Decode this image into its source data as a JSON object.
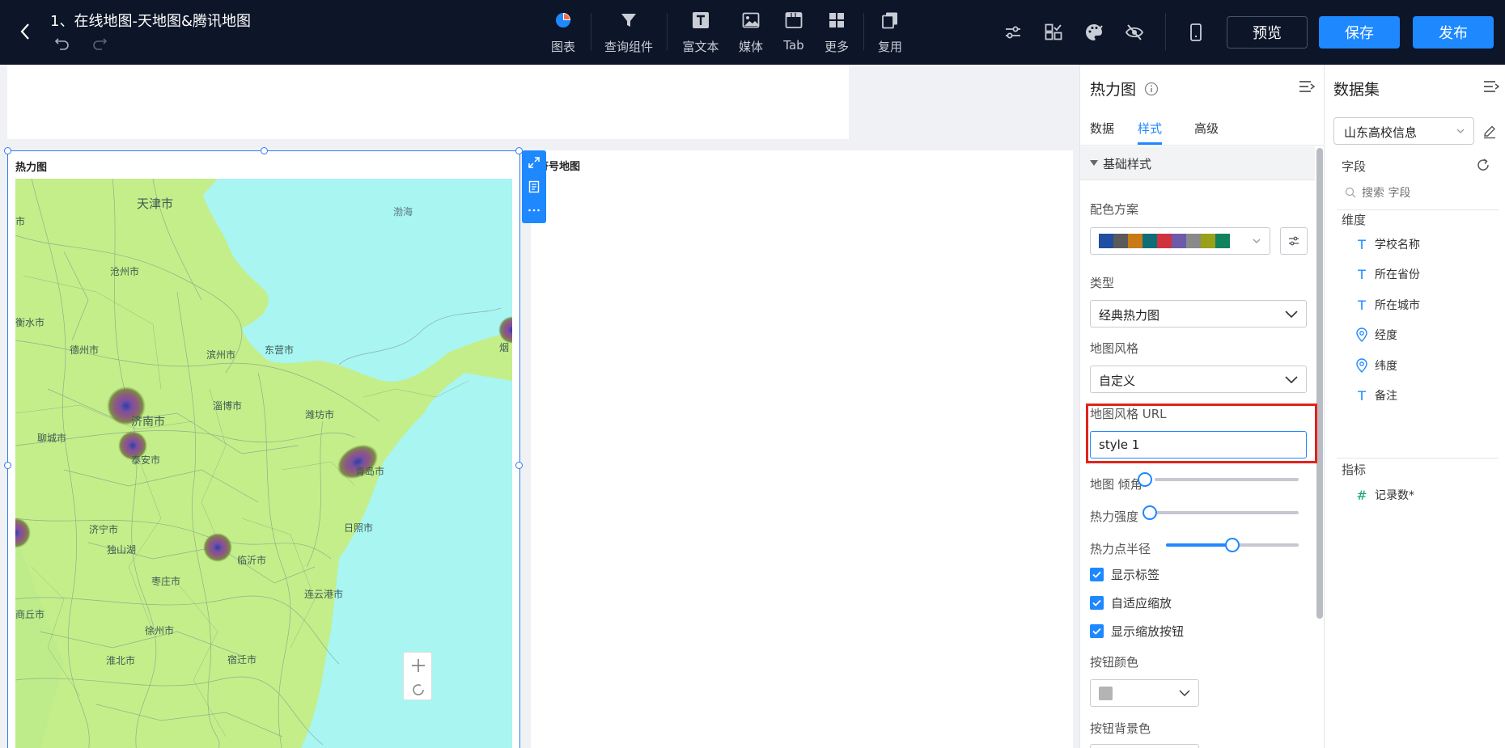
{
  "header": {
    "title": "1、在线地图-天地图&腾讯地图",
    "toolbar": {
      "chart": "图表",
      "query": "查询组件",
      "richtext": "富文本",
      "media": "媒体",
      "tab": "Tab",
      "more": "更多",
      "reuse": "复用"
    },
    "buttons": {
      "preview": "预览",
      "save": "保存",
      "publish": "发布"
    }
  },
  "canvas": {
    "heatmap_card_title": "热力图",
    "symbol_map_card_title": "符号地图",
    "map_labels": {
      "tianjin": "天津市",
      "bohai": "渤海",
      "cangzhou": "沧州市",
      "hengshui": "衡水市",
      "dezhou": "德州市",
      "binzhou": "滨州市",
      "dongying": "东营市",
      "yantai": "烟",
      "zibo": "淄博市",
      "weifang": "潍坊市",
      "jinan": "济南市",
      "liaocheng": "聊城市",
      "taian": "泰安市",
      "qingdao": "青岛市",
      "jining": "济宁市",
      "rizhao": "日照市",
      "dushanhu": "独山湖",
      "linyi": "临沂市",
      "zaozhuang": "枣庄市",
      "lianyungang": "连云港市",
      "xuzhou": "徐州市",
      "suqian": "宿迁市",
      "huaibei": "淮北市",
      "shangqiu": "商丘市",
      "shi_left": "市"
    }
  },
  "properties": {
    "header": "热力图",
    "tabs": [
      "数据",
      "样式",
      "高级"
    ],
    "active_tab": "样式",
    "section": "基础样式",
    "color_scheme_label": "配色方案",
    "color_scheme": [
      "#1f4ea3",
      "#5a5a5a",
      "#c87a17",
      "#0f6d78",
      "#cf3340",
      "#6d5aa8",
      "#8a8a8a",
      "#9aa01a",
      "#12815f"
    ],
    "type_label": "类型",
    "type_value": "经典热力图",
    "map_style_label": "地图风格",
    "map_style_value": "自定义",
    "map_style_url_label": "地图风格 URL",
    "map_style_url_value": "style 1",
    "map_tilt_label": "地图 倾角",
    "map_tilt": 0,
    "heat_intensity_label": "热力强度",
    "heat_intensity": 0,
    "heat_radius_label": "热力点半径",
    "heat_radius": 0.5,
    "show_label": "显示标签",
    "auto_zoom": "自适应缩放",
    "show_zoom_buttons": "显示缩放按钮",
    "button_color_label": "按钮颜色",
    "button_bg_color_label": "按钮背景色"
  },
  "dataset": {
    "header": "数据集",
    "selected": "山东高校信息",
    "fields_label": "字段",
    "search_placeholder": "搜索 字段",
    "dimensions_label": "维度",
    "dimensions": [
      {
        "name": "学校名称",
        "icon": "text-type-icon"
      },
      {
        "name": "所在省份",
        "icon": "text-type-icon"
      },
      {
        "name": "所在城市",
        "icon": "text-type-icon"
      },
      {
        "name": "经度",
        "icon": "location-pin-icon"
      },
      {
        "name": "纬度",
        "icon": "location-pin-icon"
      },
      {
        "name": "备注",
        "icon": "text-type-icon"
      }
    ],
    "metrics_label": "指标",
    "metrics": [
      {
        "name": "记录数*",
        "icon": "number-hash-icon"
      }
    ]
  }
}
